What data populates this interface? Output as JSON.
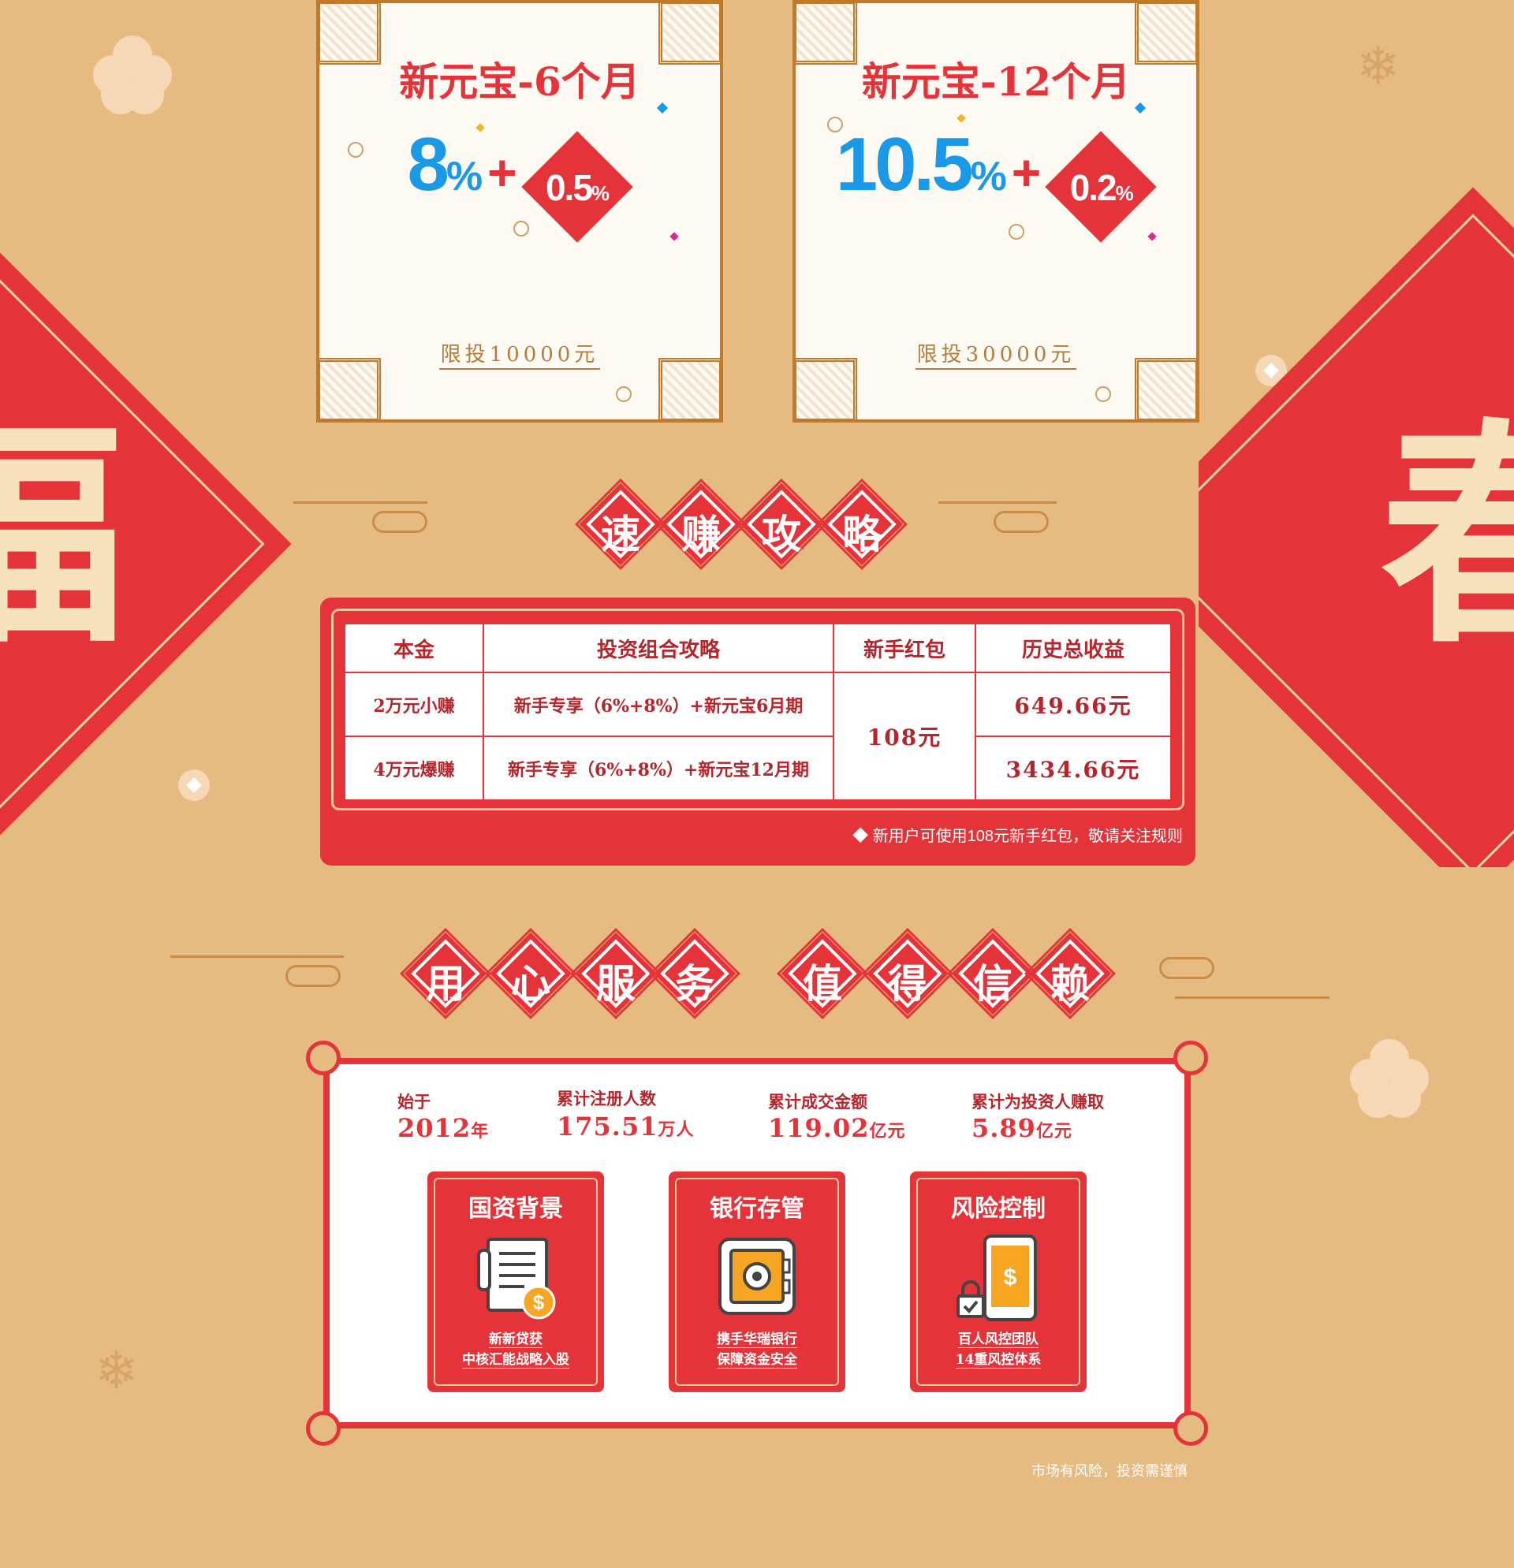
{
  "banners": {
    "left_char": "福",
    "right_char": "春"
  },
  "products": [
    {
      "title": "新元宝-6个月",
      "rate": "8",
      "rate_unit": "%",
      "plus": "+",
      "bonus": "0.5",
      "bonus_unit": "%",
      "limit": "限投10000元"
    },
    {
      "title": "新元宝-12个月",
      "rate": "10.5",
      "rate_unit": "%",
      "plus": "+",
      "bonus": "0.2",
      "bonus_unit": "%",
      "limit": "限投30000元"
    }
  ],
  "strategy": {
    "heading": [
      "速",
      "赚",
      "攻",
      "略"
    ],
    "headers": [
      "本金",
      "投资组合攻略",
      "新手红包",
      "历史总收益"
    ],
    "rows": [
      {
        "principal": "2万元小赚",
        "combo": "新手专享（6%+8%）+新元宝6月期",
        "earnings": "649.66元"
      },
      {
        "principal": "4万元爆赚",
        "combo": "新手专享（6%+8%）+新元宝12月期",
        "earnings": "3434.66元"
      }
    ],
    "red_packet": "108元",
    "note": "◆ 新用户可使用108元新手红包，敬请关注规则"
  },
  "trust": {
    "heading_a": [
      "用",
      "心",
      "服",
      "务"
    ],
    "heading_b": [
      "值",
      "得",
      "信",
      "赖"
    ],
    "stats": [
      {
        "label": "始于",
        "value": "2012",
        "unit": "年"
      },
      {
        "label": "累计注册人数",
        "value": "175.51",
        "unit": "万人"
      },
      {
        "label": "累计成交金额",
        "value": "119.02",
        "unit": "亿元"
      },
      {
        "label": "累计为投资人赚取",
        "value": "5.89",
        "unit": "亿元"
      }
    ],
    "features": [
      {
        "title": "国资背景",
        "icon": "document-coin-icon",
        "line1": "新新贷获",
        "line2": "中核汇能战略入股"
      },
      {
        "title": "银行存管",
        "icon": "safe-icon",
        "line1": "携手华瑞银行",
        "line2": "保障资金安全"
      },
      {
        "title": "风险控制",
        "icon": "phone-lock-icon",
        "line1": "百人风控团队",
        "line2": "14重风控体系"
      }
    ]
  },
  "footer": {
    "risk": "市场有风险，投资需谨慎"
  },
  "colors": {
    "background": "#e6bb82",
    "red": "#e5333a",
    "blue": "#1a9ae6",
    "gold": "#c17a28"
  }
}
